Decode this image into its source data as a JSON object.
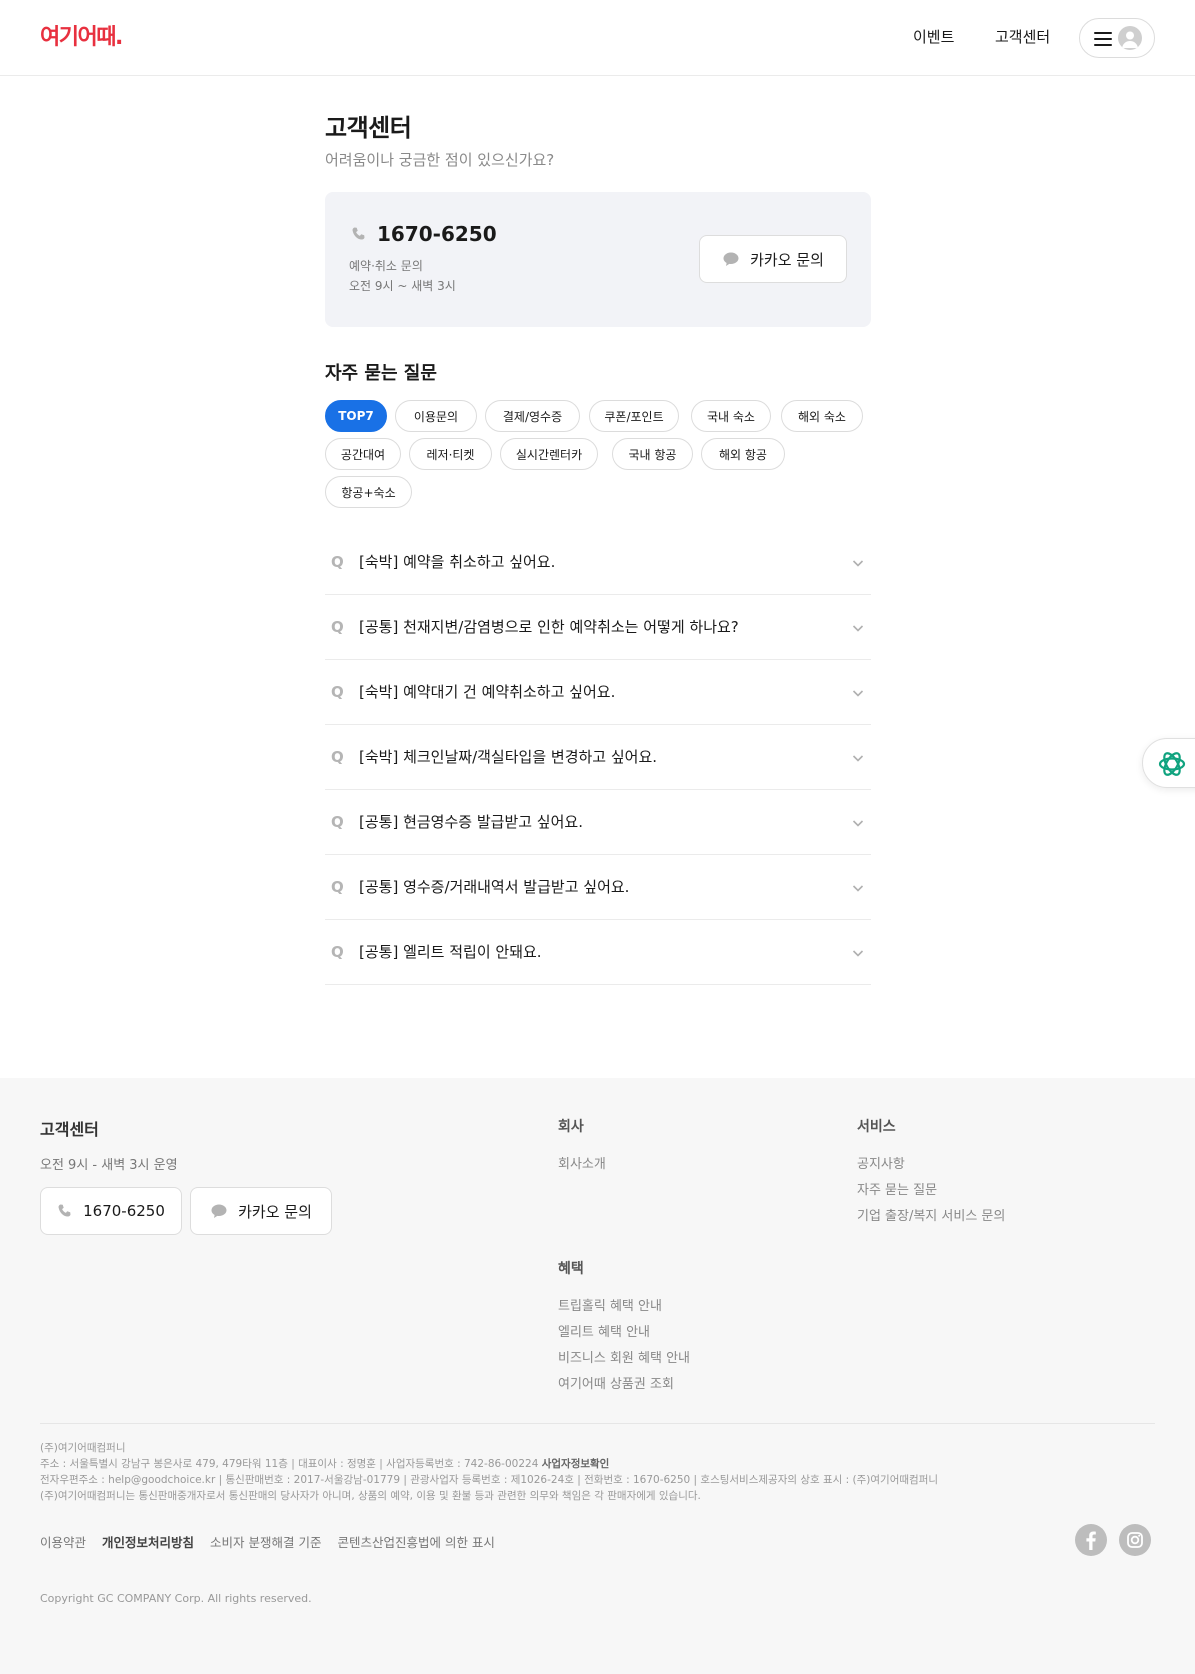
{
  "header": {
    "logo": "여기어때.",
    "nav": [
      "이벤트",
      "고객센터"
    ]
  },
  "main": {
    "title": "고객센터",
    "subtitle": "어려움이나 궁금한 점이 있으신가요?",
    "contact": {
      "phone": "1670-6250",
      "desc": "예약·취소 문의",
      "hours": "오전 9시 ~ 새벽 3시",
      "kakao_label": "카카오 문의"
    },
    "faq_title": "자주 묻는 질문",
    "categories": [
      "TOP7",
      "이용문의",
      "결제/영수증",
      "쿠폰/포인트",
      "국내 숙소",
      "해외 숙소",
      "공간대여",
      "레저·티켓",
      "실시간렌터카",
      "국내 항공",
      "해외 항공",
      "항공+숙소"
    ],
    "active_category": "TOP7",
    "faq_marker": "Q",
    "faqs": [
      "[숙박] 예약을 취소하고 싶어요.",
      "[공통] 천재지변/감염병으로 인한 예약취소는 어떻게 하나요?",
      "[숙박] 예약대기 건 예약취소하고 싶어요.",
      "[숙박] 체크인날짜/객실타입을 변경하고 싶어요.",
      "[공통] 현금영수증 발급받고 싶어요.",
      "[공통] 영수증/거래내역서 발급받고 싶어요.",
      "[공통] 엘리트 적립이 안돼요."
    ]
  },
  "footer": {
    "cs_title": "고객센터",
    "cs_hours": "오전 9시 - 새벽 3시 운영",
    "phone": "1670-6250",
    "kakao_label": "카카오 문의",
    "company_title": "회사",
    "company_links": [
      "회사소개"
    ],
    "service_title": "서비스",
    "service_links": [
      "공지사항",
      "자주 묻는 질문",
      "기업 출장/복지 서비스 문의"
    ],
    "benefit_title": "혜택",
    "benefit_links": [
      "트립홀릭 혜택 안내",
      "엘리트 혜택 안내",
      "비즈니스 회원 혜택 안내",
      "여기어때 상품권 조회"
    ],
    "company_info": {
      "name": "(주)여기어때컴퍼니",
      "line1": "주소 : 서울특별시 강남구 봉은사로 479, 479타워 11층 | 대표이사 : 정명훈 | 사업자등록번호 : 742-86-00224",
      "line1_link": "사업자정보확인",
      "line2": "전자우편주소 : help@goodchoice.kr | 통신판매번호 : 2017-서울강남-01779 | 관광사업자 등록번호 : 제1026-24호 | 전화번호 : 1670-6250 | 호스팅서비스제공자의 상호 표시 : (주)여기어때컴퍼니",
      "line3": "(주)여기어때컴퍼니는 통신판매중개자로서 통신판매의 당사자가 아니며, 상품의 예약, 이용 및 환불 등과 관련한 의무와 책임은 각 판매자에게 있습니다."
    },
    "policy_links": [
      "이용약관",
      "개인정보처리방침",
      "소비자 분쟁해결 기준",
      "콘텐츠산업진흥법에 의한 표시"
    ],
    "copyright": "Copyright GC COMPANY Corp. All rights reserved."
  },
  "icons": [
    "phone-icon",
    "chat-bubble-icon",
    "chevron-down-icon",
    "hamburger-icon",
    "user-avatar-icon",
    "ai-assistant-icon",
    "facebook-icon",
    "instagram-icon"
  ],
  "colors": {
    "brand": "#e8303f",
    "accent": "#1971e6",
    "assistant": "#10a37f"
  }
}
